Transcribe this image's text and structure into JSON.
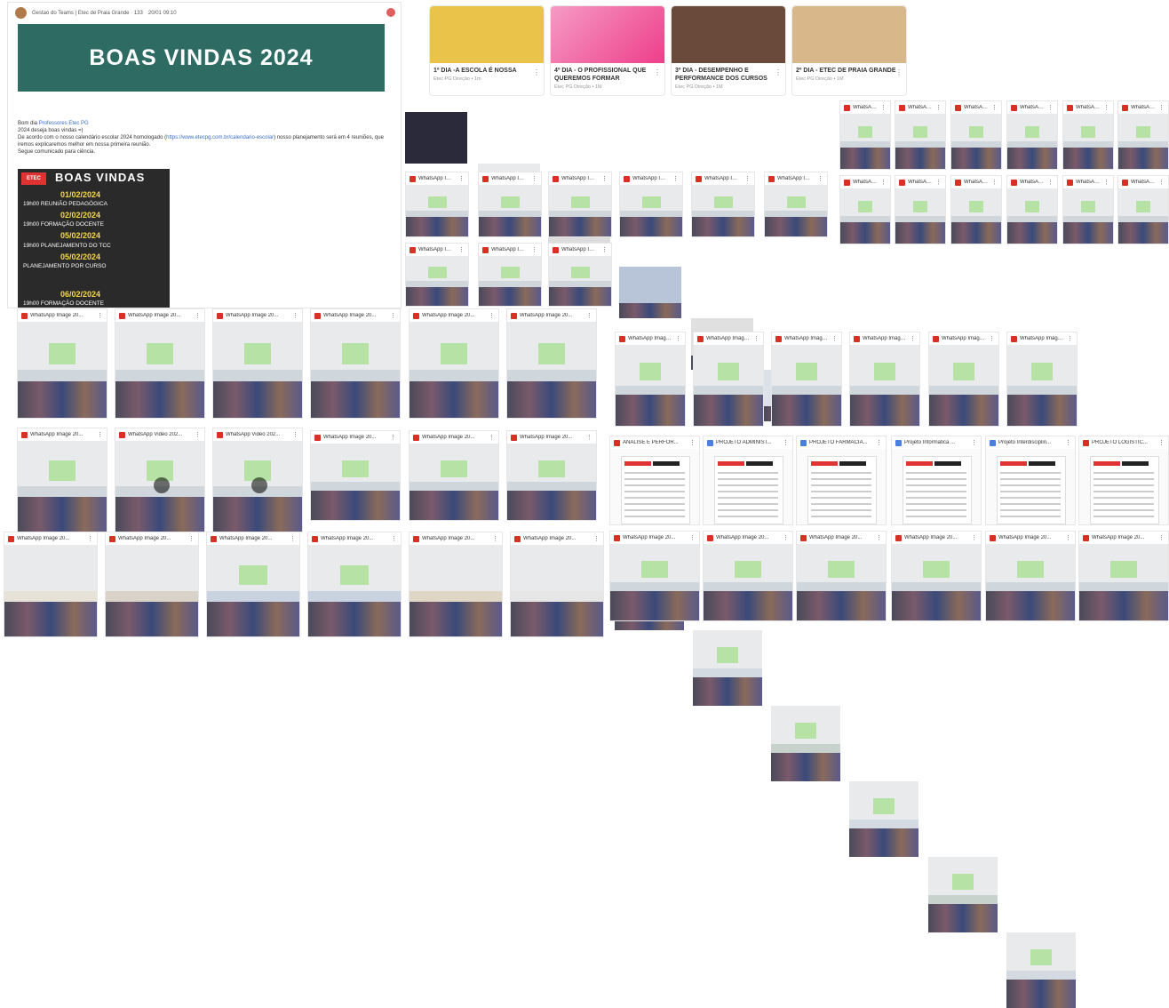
{
  "post": {
    "header": "Gestao do Teams | Etec de Praia Grande · 133",
    "header_date": "20/01 09:10",
    "banner": "BOAS VINDAS 2024",
    "greeting_prefix": "Bom dia ",
    "greeting_mention": "Professores Etec PG",
    "line2": "2024 deseja boas vindas =)",
    "line3_prefix": "De acordo com o nosso calendário escolar 2024 homologado (",
    "line3_link": "https://www.etecpg.com.br/calendario-escolar",
    "line3_suffix": ") nosso planejamento será em 4 reuniões, que iremos explicaremos melhor em nossa primeira reunião.",
    "line4": "Segue comunicado para ciência.",
    "poster": {
      "logo": "ETEC",
      "title": "BOAS VINDAS",
      "items": [
        {
          "date": "01/02/2024",
          "event": "19h00 REUNIÃO PEDAGÓGICA"
        },
        {
          "date": "02/02/2024",
          "event": "19h00 FORMAÇÃO DOCENTE"
        },
        {
          "date": "05/02/2024",
          "event": "19h00 PLANEJAMENTO DO TCC"
        },
        {
          "date": "05/02/2024",
          "event": "PLANEJAMENTO POR CURSO"
        },
        {
          "date": "06/02/2024",
          "event": "19h00 FORMAÇÃO DOCENTE"
        }
      ]
    }
  },
  "cards": [
    {
      "title": "1º DIA -A ESCOLA É NOSSA",
      "sub": "Etec PG Direção • 1m",
      "color": "#e9c34a"
    },
    {
      "title": "4º DIA - O PROFISSIONAL QUE QUEREMOS FORMAR",
      "sub": "Etec PG Direção • 1M",
      "color": "#f06aa8"
    },
    {
      "title": "3º DIA - DESEMPENHO E PERFORMANCE DOS CURSOS",
      "sub": "Etec PG Direção • 1M",
      "color": "#6a4a3a"
    },
    {
      "title": "2º DIA - ETEC DE PRAIA GRANDE",
      "sub": "Etec PG Direção • 1M",
      "color": "#d8b88a"
    }
  ],
  "tiles": {
    "whatsapp_image": "WhatsApp Image 20...",
    "whatsapp_video": "WhatsApp Video 202...",
    "docs": [
      "ANALISE E PERFOR...",
      "PROJETO ADMINIST...",
      "PROJETO FARMACIA...",
      "Projeto Informatica ...",
      "Projeto Interdisciplin...",
      "PROJETO LOGISTIC..."
    ]
  },
  "colors": {
    "banner": "#2e6b63",
    "pdf_icon": "#d93025",
    "doc_icon": "#4a7fe0"
  }
}
